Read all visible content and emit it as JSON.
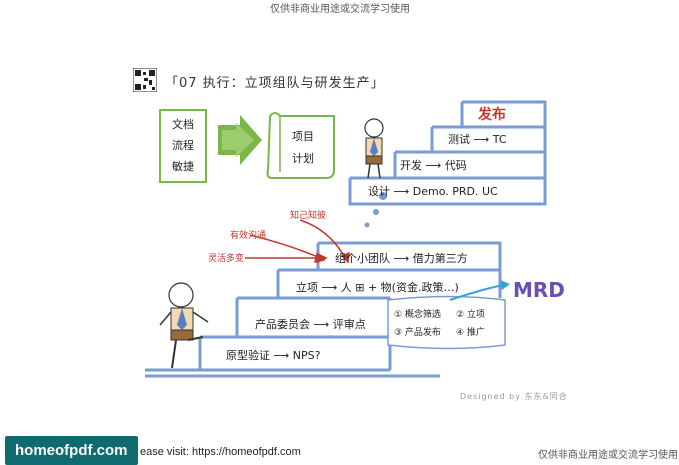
{
  "watermark_top": "仅供非商业用途或交流学习使用",
  "watermark_bottom": "仅供非商业用途或交流学习使用",
  "title": "「07 执行：立项组队与研发生产」",
  "left_box": [
    "文档",
    "流程",
    "敏捷"
  ],
  "scroll_box": [
    "项目",
    "计划"
  ],
  "steps_upper": {
    "s1": "发布",
    "s2": "测试 ⟶ TC",
    "s3": "开发 ⟶ 代码",
    "s4": "设计 ⟶ Demo. PRD. UC"
  },
  "steps_lower": {
    "team": "组个小团队 ⟶ 借力第三方",
    "project": "立项 ⟶ 人 ⊞ + 物(资金.政策…)",
    "committee": "产品委员会 ⟶ 评审点",
    "prototype": "原型验证 ⟶ NPS?"
  },
  "review_points": [
    "① 概念筛选",
    "② 立项",
    "③ 产品发布",
    "④ 推广"
  ],
  "mrd": "MRD",
  "arrows": {
    "a1": "知己知彼",
    "a2": "有效沟通",
    "a3": "灵活多变"
  },
  "designed_by": "Designed by 东东&同合",
  "footer": {
    "brand": "homeofpdf.com",
    "visit": "ease visit: https://homeofpdf.com"
  },
  "colors": {
    "stair_line": "#7a9bd6",
    "red": "#c0392b",
    "orange": "#e6732b",
    "green": "#7ab648",
    "purple": "#6a4fb3",
    "footer_bg": "#0f6b70"
  }
}
